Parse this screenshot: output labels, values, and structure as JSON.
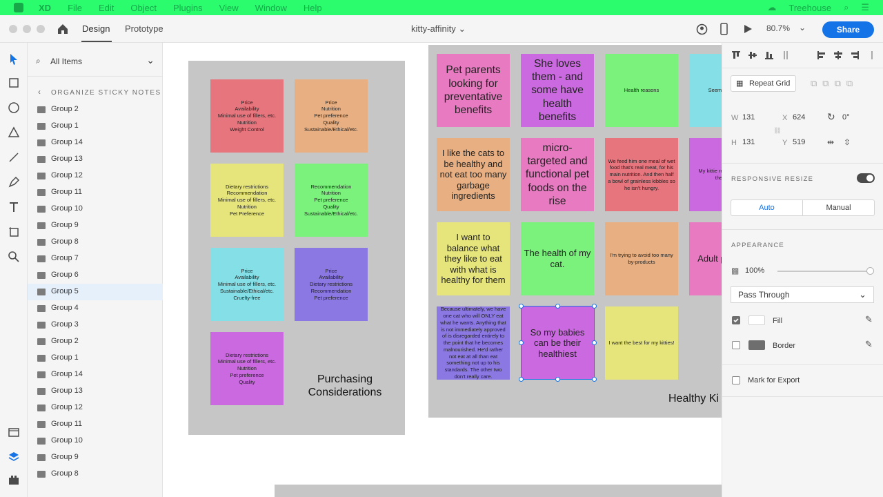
{
  "menubar": {
    "app": "XD",
    "items": [
      "File",
      "Edit",
      "Object",
      "Plugins",
      "View",
      "Window",
      "Help"
    ],
    "user": "Treehouse"
  },
  "titlebar": {
    "tab_design": "Design",
    "tab_prototype": "Prototype",
    "document_title": "kitty-affinity",
    "zoom": "80.7%",
    "share_label": "Share"
  },
  "layers": {
    "search_label": "All Items",
    "header": "ORGANIZE STICKY NOTES",
    "items": [
      "Group 2",
      "Group 1",
      "Group 14",
      "Group 13",
      "Group 12",
      "Group 11",
      "Group 10",
      "Group 9",
      "Group 8",
      "Group 7",
      "Group 6",
      "Group 5",
      "Group 4",
      "Group 3",
      "Group 2",
      "Group 1",
      "Group 14",
      "Group 13",
      "Group 12",
      "Group 11",
      "Group 10",
      "Group 9",
      "Group 8"
    ],
    "selected_index": 11
  },
  "canvas": {
    "board1": {
      "title": "Purchasing\nConsiderations",
      "notes": [
        {
          "text": "Price\nAvailability\nMinimal use of fillers, etc.\nNutrition\nWeight Control",
          "color": "#e7757d"
        },
        {
          "text": "Price\nNutrition\nPet preference\nQuality\nSustainable/Ethical/etc.",
          "color": "#e8b082"
        },
        {
          "text": "Dietary restrictions\nRecommendation\nMinimal use of fillers, etc.\nNutrition\nPet Preference",
          "color": "#e6e57c"
        },
        {
          "text": "Recommendation\nNutrition\nPet preference\nQuality\nSustainable/Ethical/etc.",
          "color": "#7af27c"
        },
        {
          "text": "Price\nAvailability\nMinimal use of fillers, etc.\nSustainable/Ethical/etc.\nCruelty-free",
          "color": "#84e0e6"
        },
        {
          "text": "Price\nAvailability\nDietary restrictions\nRecommendation\nPet preference",
          "color": "#8b78e2"
        },
        {
          "text": "Dietary restrictions\nMinimal use of fillers, etc.\nNutrition\nPet preference\nQuality",
          "color": "#cb6ae0"
        }
      ]
    },
    "board2": {
      "title": "Healthy Ki",
      "notes": [
        {
          "text": "Pet parents looking for preventative benefits",
          "color": "#e77ac0",
          "size": "huge"
        },
        {
          "text": "She loves them - and some have health benefits",
          "color": "#cb6ae0",
          "size": "huge"
        },
        {
          "text": "Health reasons",
          "color": "#7af27c",
          "size": "small"
        },
        {
          "text": "Seem thoug he",
          "color": "#84e0e6",
          "size": "small"
        },
        {
          "text": "I like the cats to be healthy and not eat too many garbage ingredients",
          "color": "#e8b082",
          "size": "big"
        },
        {
          "text": "micro-targeted and functional pet foods on the rise",
          "color": "#e77ac0",
          "size": "huge"
        },
        {
          "text": "We feed him one meal of wet food that's real meat, for his main nutrition. And then half a bowl of grainless kibbles so he isn't hungry.",
          "color": "#e7757d",
          "size": "small"
        },
        {
          "text": "My kittie restrictio better these typ",
          "color": "#cb6ae0",
          "size": "small"
        },
        {
          "text": "I want to balance what they like to eat with what is healthy for them",
          "color": "#e6e57c",
          "size": "big"
        },
        {
          "text": "The health of my cat.",
          "color": "#7af27c",
          "size": "big"
        },
        {
          "text": "I'm trying to avoid too many by-products",
          "color": "#e8b082",
          "size": "small"
        },
        {
          "text": "Adult pets in k",
          "color": "#e77ac0",
          "size": "big"
        },
        {
          "text": "Because ultimately, we have one cat who will ONLY eat what he wants. Anything that is not immediately approved of is disregarded entirely to the point that he becomes malnourished. He'd rather not eat at all than eat something not up to his standards. The other two don't really care.",
          "color": "#8b78e2",
          "size": "small"
        },
        {
          "text": "So my babies can be their healthiest",
          "color": "#cb6ae0",
          "size": "big"
        },
        {
          "text": "I want the best for my kitties!",
          "color": "#e6e57c",
          "size": "small"
        }
      ]
    }
  },
  "props": {
    "repeat_grid": "Repeat Grid",
    "w_label": "W",
    "w_value": "131",
    "x_label": "X",
    "x_value": "624",
    "rotation": "0°",
    "h_label": "H",
    "h_value": "131",
    "y_label": "Y",
    "y_value": "519",
    "responsive_label": "RESPONSIVE RESIZE",
    "auto_label": "Auto",
    "manual_label": "Manual",
    "appearance_label": "APPEARANCE",
    "opacity": "100%",
    "opacity_level": 1.0,
    "blend_mode": "Pass Through",
    "fill_label": "Fill",
    "border_label": "Border",
    "export_label": "Mark for Export"
  },
  "colors": {
    "menubar": "#2afc6e",
    "accent": "#1473e6"
  }
}
